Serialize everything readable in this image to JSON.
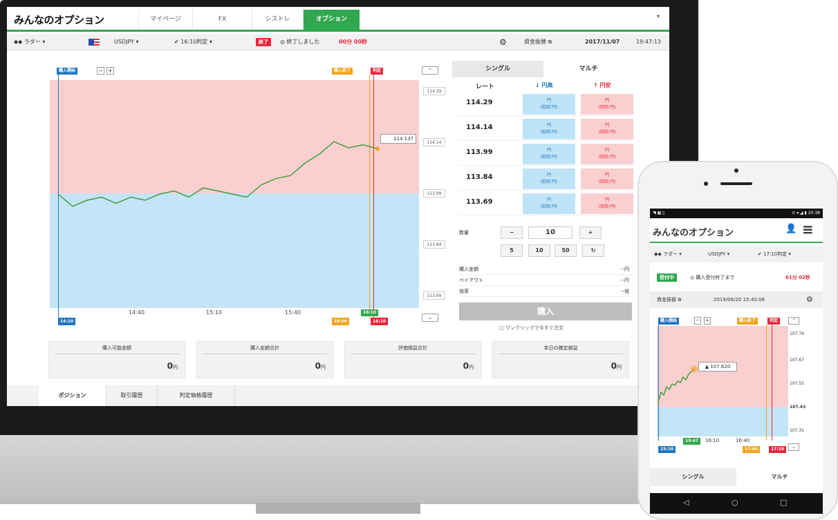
{
  "app": {
    "logo": "みんなのオプション",
    "tabs": [
      {
        "label": "マイページ",
        "active": false
      },
      {
        "label": "FX",
        "active": false
      },
      {
        "label": "シストレ",
        "active": false
      },
      {
        "label": "オプション",
        "active": true
      }
    ],
    "nav_dropdown_icon": "▾"
  },
  "toolbar": {
    "type_label": "◆◆ ラダー",
    "pair_label": "USDJPY",
    "judge_label": "✔ 16:10判定",
    "status_badge": "終了",
    "status_text": "◎ 終了しました",
    "status_time": "00分 00秒",
    "gear_icon": "⚙",
    "deposit_label": "資金振替 ⧉",
    "date": "2017/11/07",
    "time": "19:47:13"
  },
  "chart": {
    "purchase_start_label": "購入開始",
    "purchase_end_label": "購入終了",
    "judge_label": "判定",
    "current_value": "114.137",
    "x_ticks": [
      "14:40",
      "15:10",
      "15:40"
    ],
    "start_time": "14:10",
    "judge_time_top": "16:10",
    "end_time": "16:00",
    "judge_time": "16:10",
    "y_ticks": [
      "114.29",
      "114.14",
      "113.99",
      "113.84",
      "113.69"
    ],
    "colors": {
      "above": "#f9cfcf",
      "below": "#c4e4f8",
      "line": "#3f9f3a"
    }
  },
  "chart_data": {
    "type": "line",
    "x": [
      "14:10",
      "14:15",
      "14:20",
      "14:25",
      "14:30",
      "14:35",
      "14:40",
      "14:45",
      "14:50",
      "14:55",
      "15:00",
      "15:05",
      "15:10",
      "15:15",
      "15:20",
      "15:25",
      "15:30",
      "15:35",
      "15:40",
      "15:45",
      "15:50",
      "15:55",
      "16:00"
    ],
    "y": [
      113.99,
      113.95,
      113.97,
      113.98,
      113.96,
      113.98,
      113.97,
      113.99,
      114.0,
      113.98,
      114.01,
      114.0,
      113.99,
      113.98,
      114.02,
      114.04,
      114.05,
      114.09,
      114.12,
      114.16,
      114.14,
      114.15,
      114.137
    ],
    "ylim": [
      113.62,
      114.36
    ]
  },
  "right_panel": {
    "tab_single": "シングル",
    "tab_multi": "マルチ",
    "col_rate": "レート",
    "col_high": "↓ 円高",
    "col_low": "↑ 円安",
    "rows": [
      {
        "rate": "114.29",
        "high": "円",
        "high_sub": "(前回 円)",
        "low": "円",
        "low_sub": "(前回 円)"
      },
      {
        "rate": "114.14",
        "high": "円",
        "high_sub": "(前回 円)",
        "low": "円",
        "low_sub": "(前回 円)"
      },
      {
        "rate": "113.99",
        "high": "円",
        "high_sub": "(前回 円)",
        "low": "円",
        "low_sub": "(前回 円)"
      },
      {
        "rate": "113.84",
        "high": "円",
        "high_sub": "(前回 円)",
        "low": "円",
        "low_sub": "(前回 円)"
      },
      {
        "rate": "113.69",
        "high": "円",
        "high_sub": "(前回 円)",
        "low": "円",
        "low_sub": "(前回 円)"
      }
    ],
    "qty_label": "数量",
    "qty_minus": "−",
    "qty_value": "10",
    "qty_plus": "+",
    "presets": [
      "5",
      "10",
      "50"
    ],
    "reset_icon": "↻",
    "info_rows": [
      {
        "label": "購入金額",
        "value": "--円"
      },
      {
        "label": "ペイアウト",
        "value": "--円"
      },
      {
        "label": "倍率",
        "value": "--倍"
      }
    ],
    "buy_button": "購入",
    "one_click": "□ ワンクリックで今すぐ注文"
  },
  "summary": [
    {
      "label": "購入可能金額",
      "value": "0",
      "unit": "円"
    },
    {
      "label": "購入金額合計",
      "value": "0",
      "unit": "円"
    },
    {
      "label": "評価損益合計",
      "value": "0",
      "unit": "円"
    },
    {
      "label": "本日の確定損益",
      "value": "0",
      "unit": "円"
    }
  ],
  "bottom_tabs": [
    "ポジション",
    "取引履歴",
    "判定価格履歴"
  ],
  "phone": {
    "status_left": "◥ ▦ ▯",
    "status_right": "⊙ ▾ ◢ ▮ 20:38",
    "logo": "みんなのオプション",
    "user_icon": "👤",
    "menu_icon": "≡",
    "type_label": "◆◆ ラダー ▾",
    "pair_label": "USDJPY ▾",
    "judge_label": "✔ 17:10判定 ▾",
    "status_badge": "受付中",
    "status_text": "◎ 購入受付終了まで",
    "countdown": "01分 02秒",
    "deposit": "資金振替 ⧉",
    "datetime": "2019/06/20  15:40:08",
    "gear_icon": "⚙",
    "purchase_start": "購入開始",
    "purchase_end": "購入終了",
    "judge": "判定",
    "current_value": "▲ 107.620",
    "y_ticks": [
      "107.79",
      "107.67",
      "107.55",
      "107.43",
      "107.31"
    ],
    "x_ticks": [
      "16:10",
      "16:40"
    ],
    "now_time": "15:47",
    "start_time": "15:10",
    "end_time": "17:05",
    "judge_time": "17:10",
    "tab_single": "シングル",
    "tab_multi": "マルチ",
    "nav_back": "◁",
    "nav_home": "○",
    "nav_recent": "□"
  }
}
